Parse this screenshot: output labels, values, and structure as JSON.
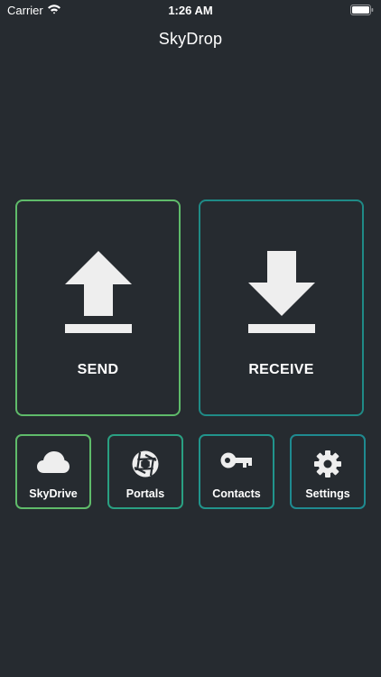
{
  "status_bar": {
    "carrier": "Carrier",
    "time": "1:26 AM",
    "wifi_icon": "wifi-icon",
    "battery_icon": "battery-icon"
  },
  "app": {
    "title": "SkyDrop"
  },
  "actions": {
    "send": {
      "label": "SEND",
      "icon": "upload-icon",
      "border_color": "#5fbb6a"
    },
    "receive": {
      "label": "RECEIVE",
      "icon": "download-icon",
      "border_color": "#1f8a86"
    }
  },
  "shortcuts": [
    {
      "label": "SkyDrive",
      "icon": "cloud-icon",
      "border_color": "#5fbb6a"
    },
    {
      "label": "Portals",
      "icon": "aperture-icon",
      "border_color": "#2aa082"
    },
    {
      "label": "Contacts",
      "icon": "key-icon",
      "border_color": "#21948c"
    },
    {
      "label": "Settings",
      "icon": "gear-icon",
      "border_color": "#1f8a90"
    }
  ],
  "colors": {
    "background": "#262b30",
    "icon": "#eeeeee"
  }
}
